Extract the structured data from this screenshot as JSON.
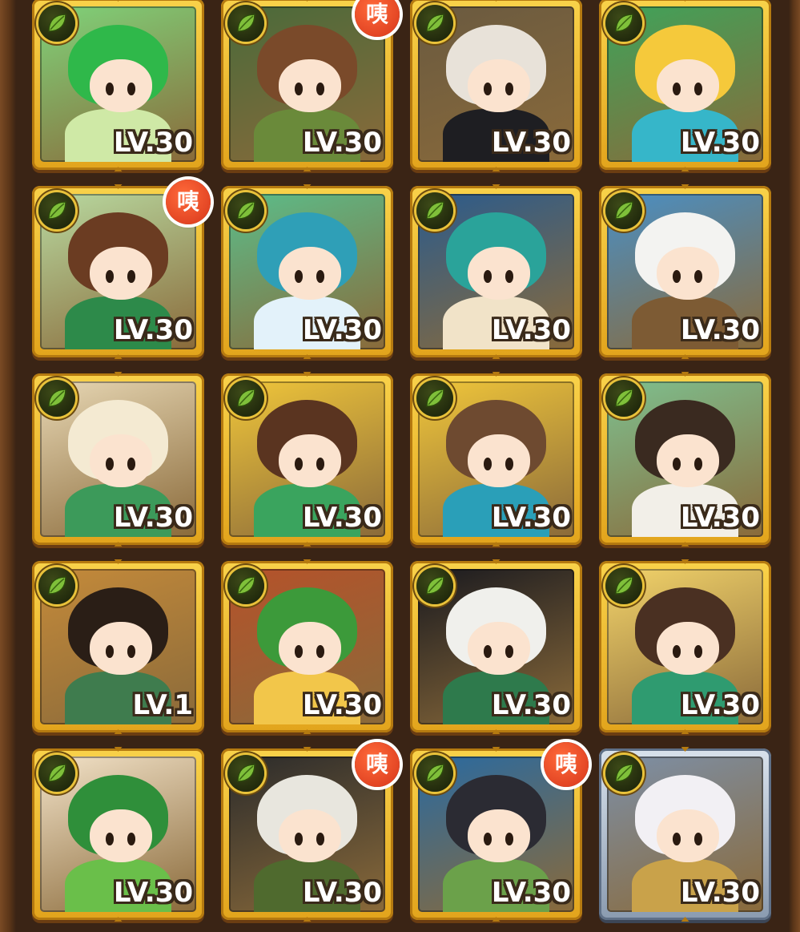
{
  "colors": {
    "background": "#3a2415",
    "card_gold": "#f2c232",
    "card_silver": "#a7b6c7",
    "level_text": "#ffffff",
    "corner_badge": "#e2411f",
    "leaf_badge": "#2b3412"
  },
  "icons": {
    "element_badge": "leaf-icon",
    "corner_badge": "wonder-badge"
  },
  "heroes": [
    {
      "level": "LV.30",
      "badge": "",
      "frame": "gold",
      "palette": [
        "#2fb84a",
        "#cfe9a6",
        "#7fd37a"
      ]
    },
    {
      "level": "LV.30",
      "badge": "咦",
      "frame": "gold",
      "palette": [
        "#7a4a2a",
        "#6a8a3a",
        "#4a6a3a"
      ]
    },
    {
      "level": "LV.30",
      "badge": "",
      "frame": "gold",
      "palette": [
        "#e8e2d9",
        "#1e1e22",
        "#6a5a40"
      ]
    },
    {
      "level": "LV.30",
      "badge": "",
      "frame": "gold",
      "palette": [
        "#f5c93b",
        "#36b6c9",
        "#3fa35a"
      ]
    },
    {
      "level": "LV.30",
      "badge": "咦",
      "frame": "gold",
      "palette": [
        "#6b3c22",
        "#2d8a4a",
        "#b8d9a0"
      ]
    },
    {
      "level": "LV.30",
      "badge": "",
      "frame": "gold",
      "palette": [
        "#2f9fb7",
        "#e3f2fa",
        "#5bbd8a"
      ]
    },
    {
      "level": "LV.30",
      "badge": "",
      "frame": "gold",
      "palette": [
        "#2aa39a",
        "#f1e3c8",
        "#2b5b8c"
      ]
    },
    {
      "level": "LV.30",
      "badge": "",
      "frame": "gold",
      "palette": [
        "#f3f3f1",
        "#7d5b34",
        "#4a8fc4"
      ]
    },
    {
      "level": "LV.30",
      "badge": "",
      "frame": "gold",
      "palette": [
        "#f4ead2",
        "#3c9a5a",
        "#e7d7b4"
      ]
    },
    {
      "level": "LV.30",
      "badge": "",
      "frame": "gold",
      "palette": [
        "#5a3420",
        "#3aa45e",
        "#f0c63a"
      ]
    },
    {
      "level": "LV.30",
      "badge": "",
      "frame": "gold",
      "palette": [
        "#6e4a30",
        "#2a9fb8",
        "#f0c63a"
      ]
    },
    {
      "level": "LV.30",
      "badge": "",
      "frame": "gold",
      "palette": [
        "#3a2a20",
        "#f2efe8",
        "#7ec08f"
      ]
    },
    {
      "level": "LV.1",
      "badge": "",
      "frame": "gold",
      "palette": [
        "#2a1e16",
        "#3f7c4e",
        "#c48a3a"
      ]
    },
    {
      "level": "LV.30",
      "badge": "",
      "frame": "gold",
      "palette": [
        "#3c9a3a",
        "#f2c64a",
        "#b5522a"
      ]
    },
    {
      "level": "LV.30",
      "badge": "",
      "frame": "gold",
      "palette": [
        "#f0f0ec",
        "#2e7a4c",
        "#1a1a1f"
      ]
    },
    {
      "level": "LV.30",
      "badge": "",
      "frame": "gold",
      "palette": [
        "#4a3022",
        "#2f9b70",
        "#f2d36a"
      ]
    },
    {
      "level": "LV.30",
      "badge": "",
      "frame": "gold",
      "palette": [
        "#2f8f3a",
        "#6abf4a",
        "#f2e2c8"
      ]
    },
    {
      "level": "LV.30",
      "badge": "咦",
      "frame": "gold",
      "palette": [
        "#e8e6de",
        "#4f6a2e",
        "#2b2b2b"
      ]
    },
    {
      "level": "LV.30",
      "badge": "咦",
      "frame": "gold",
      "palette": [
        "#2b2b33",
        "#6ba14a",
        "#2a6aa0"
      ]
    },
    {
      "level": "LV.30",
      "badge": "",
      "frame": "silver",
      "palette": [
        "#f2f0f4",
        "#c9a24a",
        "#7d8fa6"
      ]
    }
  ]
}
